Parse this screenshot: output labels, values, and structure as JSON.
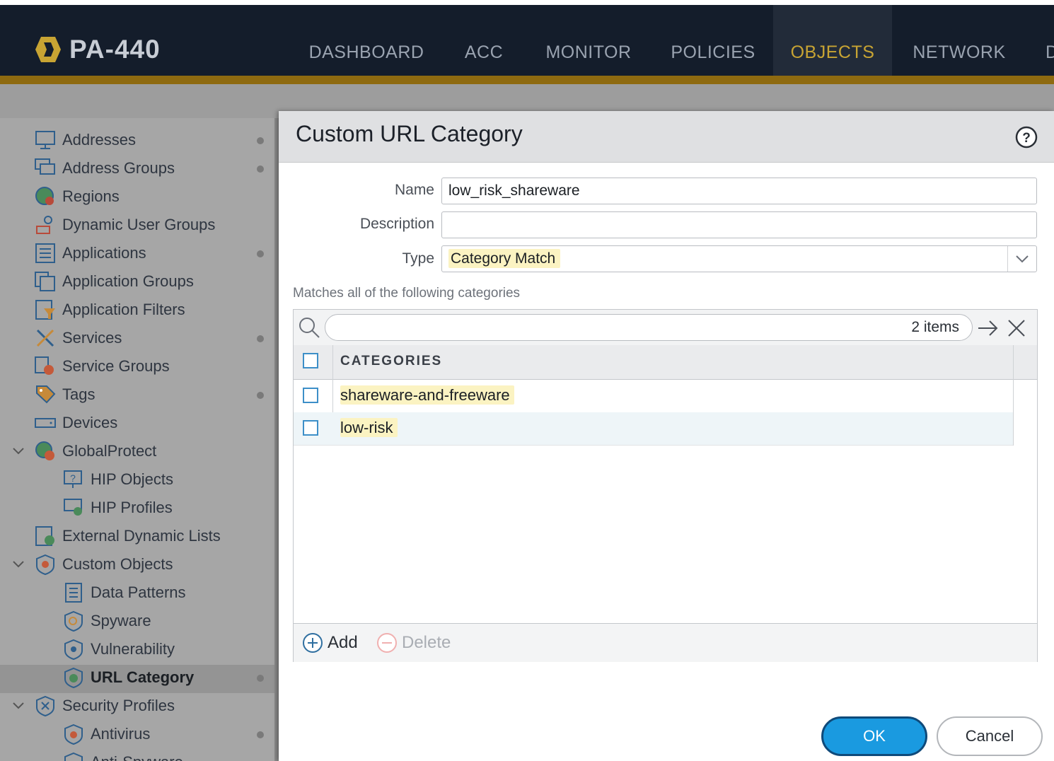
{
  "app": {
    "device_name": "PA-440",
    "nav_tabs": [
      {
        "label": "DASHBOARD",
        "active": false
      },
      {
        "label": "ACC",
        "active": false
      },
      {
        "label": "MONITOR",
        "active": false
      },
      {
        "label": "POLICIES",
        "active": false
      },
      {
        "label": "OBJECTS",
        "active": true
      },
      {
        "label": "NETWORK",
        "active": false
      }
    ],
    "colors": {
      "nav_bg": "#141d2b",
      "active_tab": "#c8a433",
      "gold_bar": "#8e6a10",
      "ok_button": "#1a9ae0"
    }
  },
  "sidebar": {
    "items": [
      {
        "label": "Addresses",
        "icon": "monitor-icon"
      },
      {
        "label": "Address Groups",
        "icon": "address-groups-icon"
      },
      {
        "label": "Regions",
        "icon": "globe-icon"
      },
      {
        "label": "Dynamic User Groups",
        "icon": "user-group-icon"
      },
      {
        "label": "Applications",
        "icon": "list-icon"
      },
      {
        "label": "Application Groups",
        "icon": "application-groups-icon"
      },
      {
        "label": "Application Filters",
        "icon": "filter-icon"
      },
      {
        "label": "Services",
        "icon": "tools-icon"
      },
      {
        "label": "Service Groups",
        "icon": "service-groups-icon"
      },
      {
        "label": "Tags",
        "icon": "tag-icon"
      },
      {
        "label": "Devices",
        "icon": "device-icon"
      },
      {
        "label": "GlobalProtect",
        "icon": "globalprotect-icon"
      },
      {
        "label": "HIP Objects",
        "icon": "hip-objects-icon"
      },
      {
        "label": "HIP Profiles",
        "icon": "hip-profiles-icon"
      },
      {
        "label": "External Dynamic Lists",
        "icon": "external-list-icon"
      },
      {
        "label": "Custom Objects",
        "icon": "custom-objects-icon"
      },
      {
        "label": "Data Patterns",
        "icon": "data-patterns-icon"
      },
      {
        "label": "Spyware",
        "icon": "spyware-icon"
      },
      {
        "label": "Vulnerability",
        "icon": "vulnerability-icon"
      },
      {
        "label": "URL Category",
        "icon": "url-category-icon"
      },
      {
        "label": "Security Profiles",
        "icon": "security-profiles-icon"
      },
      {
        "label": "Antivirus",
        "icon": "antivirus-icon"
      },
      {
        "label": "Anti-Spyware",
        "icon": "anti-spyware-icon"
      }
    ],
    "selected": "URL Category"
  },
  "dialog": {
    "title": "Custom URL Category",
    "name_label": "Name",
    "name_value": "low_risk_shareware",
    "description_label": "Description",
    "description_value": "",
    "type_label": "Type",
    "type_value": "Category Match",
    "matches_label": "Matches all of the following categories",
    "search": {
      "placeholder": "",
      "count": "2 items"
    },
    "grid": {
      "column_header": "CATEGORIES",
      "rows": [
        "shareware-and-freeware",
        "low-risk"
      ]
    },
    "add_label": "Add",
    "delete_label": "Delete",
    "ok_label": "OK",
    "cancel_label": "Cancel"
  }
}
